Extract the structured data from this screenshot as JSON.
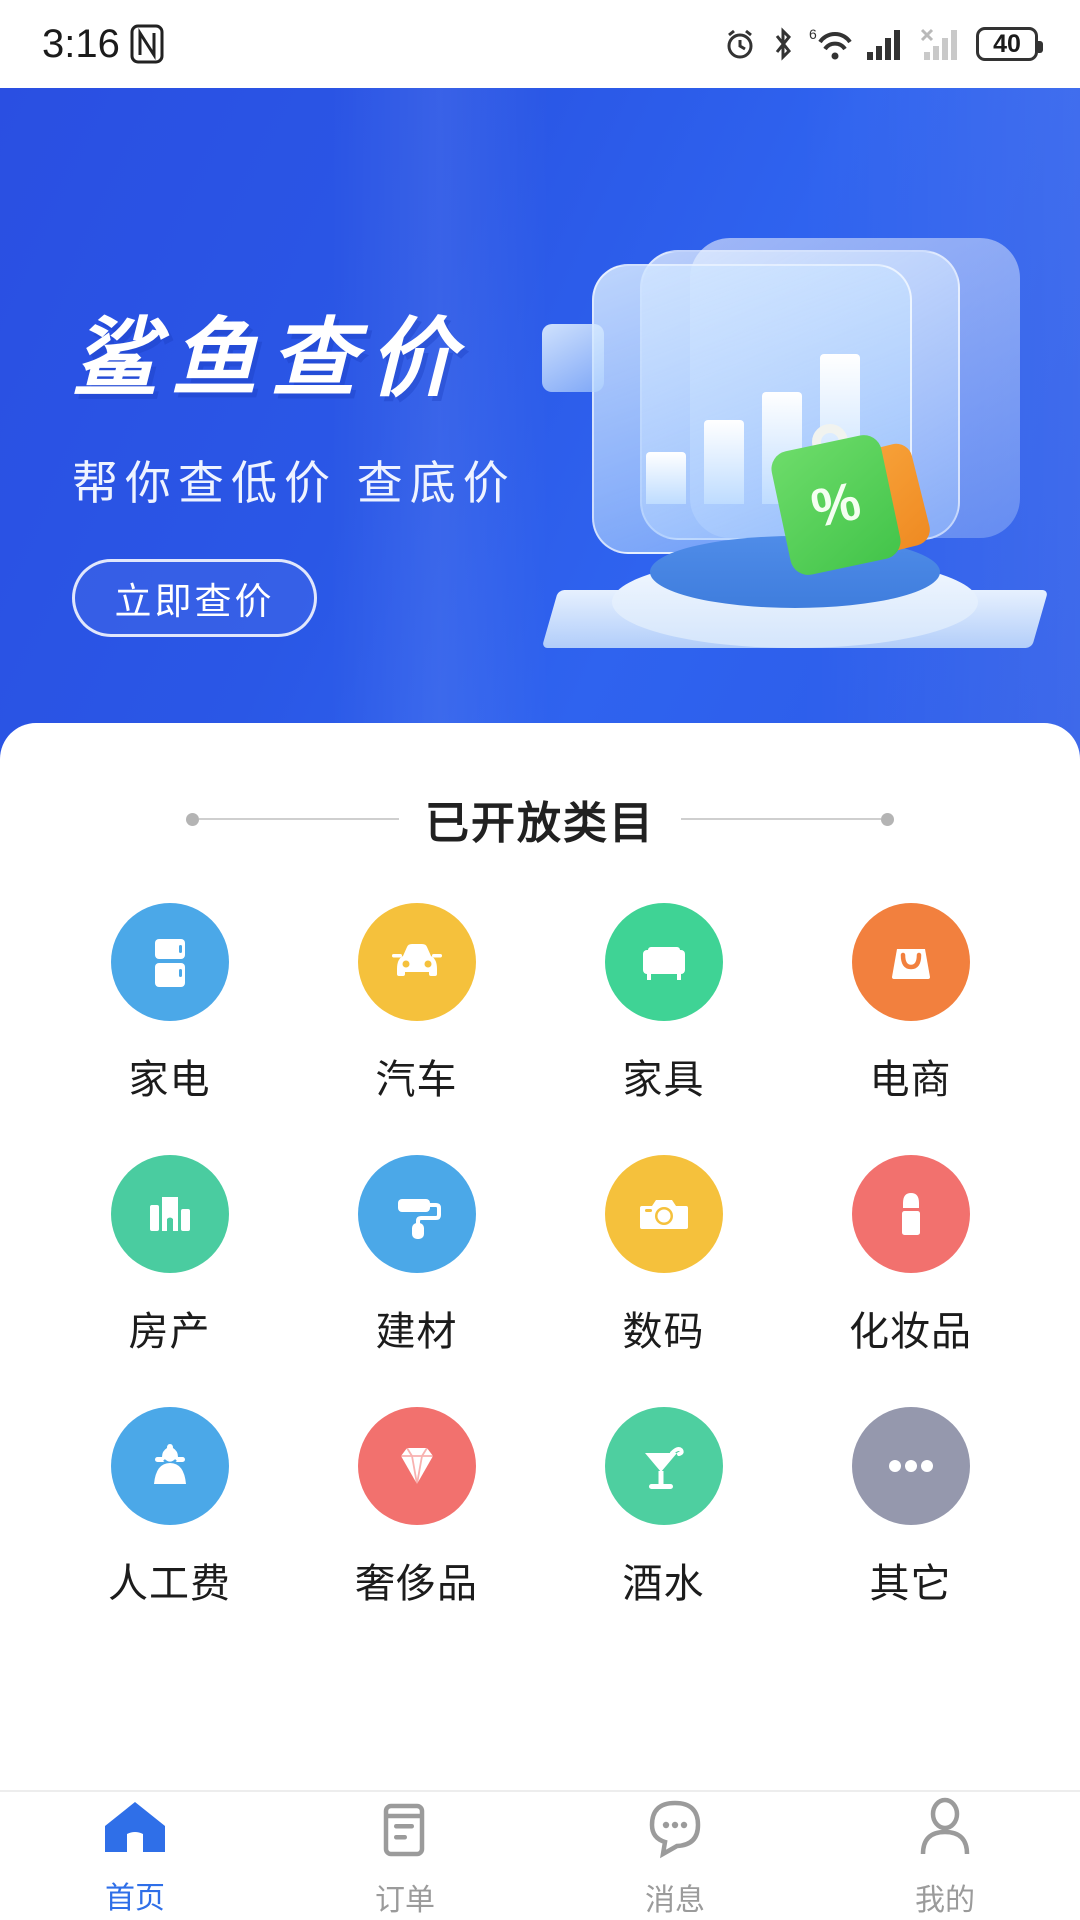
{
  "status_bar": {
    "time": "3:16",
    "battery_level": "40",
    "icons": [
      "nfc-icon",
      "alarm-icon",
      "bluetooth-icon",
      "wifi-6-icon",
      "signal-bars-icon",
      "signal-no-sim-icon",
      "battery-icon"
    ]
  },
  "banner": {
    "title": "鲨鱼查价",
    "subtitle": "帮你查低价  查底价",
    "cta_label": "立即查价",
    "bg_color": "#2a57e6",
    "tag_percent": "%",
    "chart_bar_heights": [
      52,
      84,
      112,
      150
    ]
  },
  "section": {
    "title": "已开放类目"
  },
  "categories": [
    {
      "label": "家电",
      "icon": "refrigerator-icon",
      "color": "#4BA8E8"
    },
    {
      "label": "汽车",
      "icon": "car-icon",
      "color": "#F5C13C"
    },
    {
      "label": "家具",
      "icon": "sofa-icon",
      "color": "#3FD395"
    },
    {
      "label": "电商",
      "icon": "shopping-bag-icon",
      "color": "#F2803E"
    },
    {
      "label": "房产",
      "icon": "building-icon",
      "color": "#4ACCA0"
    },
    {
      "label": "建材",
      "icon": "paint-roller-icon",
      "color": "#4BA8E8"
    },
    {
      "label": "数码",
      "icon": "camera-icon",
      "color": "#F5C13C"
    },
    {
      "label": "化妆品",
      "icon": "lipstick-icon",
      "color": "#F2716E"
    },
    {
      "label": "人工费",
      "icon": "worker-icon",
      "color": "#4BA8E8"
    },
    {
      "label": "奢侈品",
      "icon": "diamond-icon",
      "color": "#F2716E"
    },
    {
      "label": "酒水",
      "icon": "cocktail-icon",
      "color": "#4ECFA0"
    },
    {
      "label": "其它",
      "icon": "ellipsis-icon",
      "color": "#9598AD"
    }
  ],
  "tabbar": {
    "active_color": "#2F6FE8",
    "inactive_color": "#9B9B9B",
    "items": [
      {
        "label": "首页",
        "icon": "home-icon",
        "active": true
      },
      {
        "label": "订单",
        "icon": "orders-icon",
        "active": false
      },
      {
        "label": "消息",
        "icon": "message-icon",
        "active": false
      },
      {
        "label": "我的",
        "icon": "profile-icon",
        "active": false
      }
    ]
  }
}
